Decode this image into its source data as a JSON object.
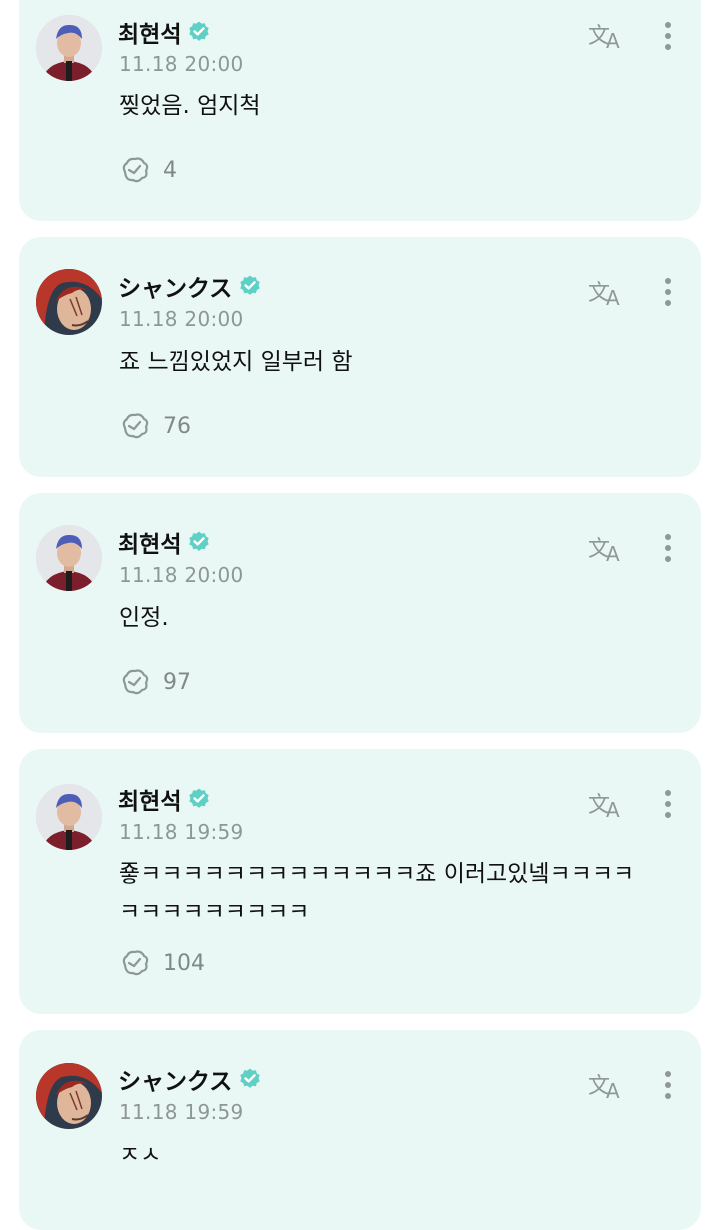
{
  "messages": [
    {
      "author": "최현석",
      "avatar": "choi-avatar",
      "verified": true,
      "time": "11.18 20:00",
      "text": "찢었음. 엄지척",
      "reaction_count": "4"
    },
    {
      "author": "シャンクス",
      "avatar": "shanks-avatar",
      "verified": true,
      "time": "11.18 20:00",
      "text": "죠 느낌있었지 일부러 함",
      "reaction_count": "76"
    },
    {
      "author": "최현석",
      "avatar": "choi-avatar",
      "verified": true,
      "time": "11.18 20:00",
      "text": "인정.",
      "reaction_count": "97"
    },
    {
      "author": "최현석",
      "avatar": "choi-avatar",
      "verified": true,
      "time": "11.18 19:59",
      "text": "죻ㅋㅋㅋㅋㅋㅋㅋㅋㅋㅋㅋㅋㅋ죠 이러고있넼ㅋㅋㅋㅋㅋㅋㅋㅋㅋㅋㅋㅋㅋ",
      "reaction_count": "104"
    },
    {
      "author": "シャンクス",
      "avatar": "shanks-avatar",
      "verified": true,
      "time": "11.18 19:59",
      "text": "ㅈㅅ",
      "reaction_count": ""
    }
  ],
  "icons": {
    "verified": "verified-badge-icon",
    "translate": "translate-icon",
    "more": "more-vertical-icon",
    "reaction": "reaction-icon"
  },
  "colors": {
    "card_background": "#eaf8f5",
    "verified_badge": "#5fd0c6",
    "timestamp": "#8d9795",
    "icon": "#8e9896"
  }
}
